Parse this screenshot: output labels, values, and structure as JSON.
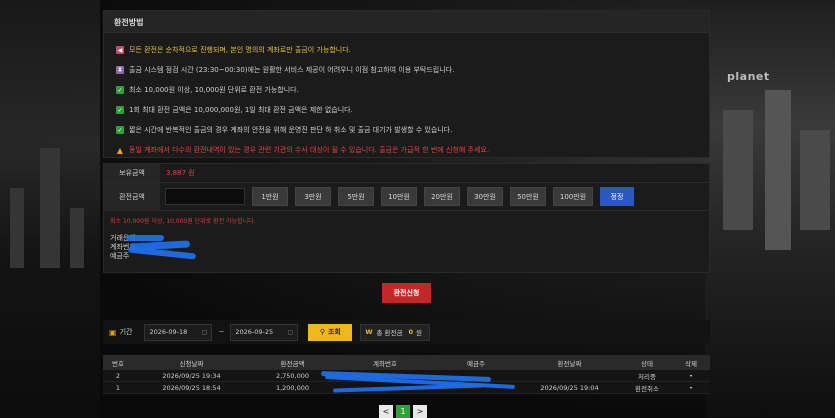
{
  "notice": {
    "title": "환전방법",
    "items": [
      {
        "text": "모든 환전은 순차적으로 진행되며, 본인 명의의 계좌로만 출금이 가능합니다.",
        "tone": "yellow",
        "icon": "megaphone-icon"
      },
      {
        "text": "출금 시스템 점검 시간 (23:30~00:30)에는 원활한 서비스 제공이 어려우니 이점 참고하여 이용 부탁드립니다.",
        "tone": "normal",
        "icon": "hourglass-icon"
      },
      {
        "text": "최소 10,000원 이상, 10,000원 단위로 환전 가능합니다.",
        "tone": "normal",
        "icon": "check-icon"
      },
      {
        "text": "1회 최대 환전 금액은 10,000,000원, 1일 최대 환전 금액은 제한 없습니다.",
        "tone": "normal",
        "icon": "check-icon"
      },
      {
        "text": "짧은 시간에 반복적인 출금의 경우 계좌의 안전을 위해 운영진 판단 하 취소 및 출금 대기가 발생할 수 있습니다.",
        "tone": "normal",
        "icon": "check-icon"
      },
      {
        "text": "동일 계좌에서 다수의 환전내역이 있는 경우 관련 기관의 수사 대상이 될 수 있습니다. 출금은 가급적 한 번에 신청해 주세요.",
        "tone": "red",
        "icon": "warning-icon"
      }
    ]
  },
  "form": {
    "balance_label": "보유금액",
    "balance_value": "3,887 원",
    "amount_label": "환전금액",
    "amount_value": "",
    "amount_buttons": [
      "1만원",
      "3만원",
      "5만원",
      "10만원",
      "20만원",
      "30만원",
      "50만원",
      "100만원"
    ],
    "reset_label": "정정",
    "hint": "최소 10,000원 이상, 10,000원 단위로 환전 가능합니다.",
    "account_lines": [
      "거래은행",
      "계좌번호",
      "예금주"
    ]
  },
  "submit_label": "환전신청",
  "filter": {
    "period_label": "기간",
    "date_from": "2026-09-18",
    "date_to": "2026-09-25",
    "separator": "~",
    "search_label": "조회",
    "total_label": "총 환전금",
    "total_count": "0",
    "total_unit": "원"
  },
  "table": {
    "headers": [
      "번호",
      "신청날짜",
      "환전금액",
      "계좌번호",
      "예금주",
      "환전날짜",
      "상태",
      "삭제"
    ],
    "rows": [
      {
        "no": "2",
        "requested": "2026/09/25 19:34",
        "amount": "2,750,000",
        "account": "",
        "holder": "",
        "processed": "",
        "status": "처리중",
        "del": "•"
      },
      {
        "no": "1",
        "requested": "2026/09/25 18:54",
        "amount": "1,200,000",
        "account": "",
        "holder": "",
        "processed": "2026/09/25 19:04",
        "status": "환전취소",
        "del": "•"
      }
    ]
  },
  "pager": {
    "prev": "<",
    "current": "1",
    "next": ">"
  },
  "bg_sign": "planet"
}
